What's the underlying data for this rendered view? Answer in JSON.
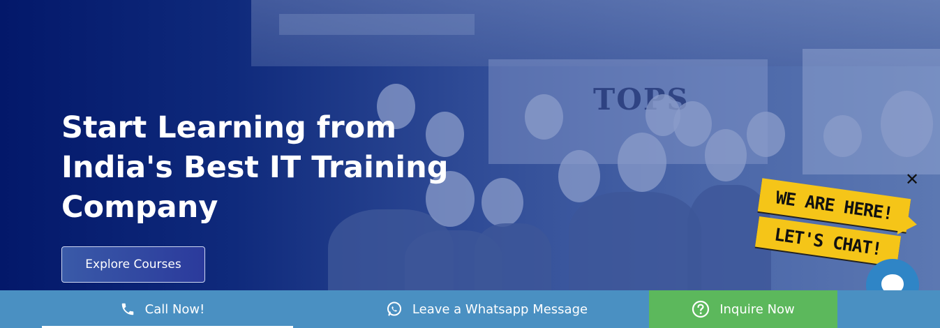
{
  "hero": {
    "title": "Start Learning from India's Best IT Training Company",
    "sign_text": "TOPS",
    "cta_label": "Explore Courses"
  },
  "chat_widget": {
    "close_symbol": "✕",
    "ribbon_line1": "WE ARE HERE!",
    "ribbon_line2": "LET'S CHAT!",
    "bubble_icon": "chat-bubble-icon"
  },
  "bottom_bar": {
    "call_label": "Call Now!",
    "whatsapp_label": "Leave a Whatsapp Message",
    "inquire_label": "Inquire Now",
    "call_icon": "phone-icon",
    "whatsapp_icon": "whatsapp-icon",
    "inquire_icon": "question-circle-icon"
  },
  "colors": {
    "bar_blue": "#4a90c2",
    "inquire_green": "#5cb85c",
    "ribbon_yellow": "#f5c518",
    "hero_dark": "#03186a"
  }
}
